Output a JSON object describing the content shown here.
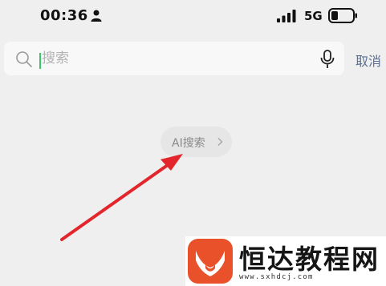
{
  "status_bar": {
    "time": "00:36",
    "network": "5G",
    "icons": [
      "person-icon",
      "signal-icon",
      "battery-icon"
    ]
  },
  "search": {
    "placeholder": "搜索",
    "value": "",
    "cancel_label": "取消",
    "icons": [
      "search-icon",
      "mic-icon"
    ]
  },
  "ai_search": {
    "label": "AI搜索",
    "icon": "chevron-right-icon"
  },
  "watermark": {
    "title": "恒达教程网",
    "url": "www.sxhdcj.com"
  },
  "colors": {
    "background": "#efefef",
    "search_box": "#f8f8f8",
    "cancel_text": "#5a6f93",
    "cursor": "#3bc46a",
    "annotation_arrow": "#e3262c",
    "logo": "#e8512a"
  }
}
